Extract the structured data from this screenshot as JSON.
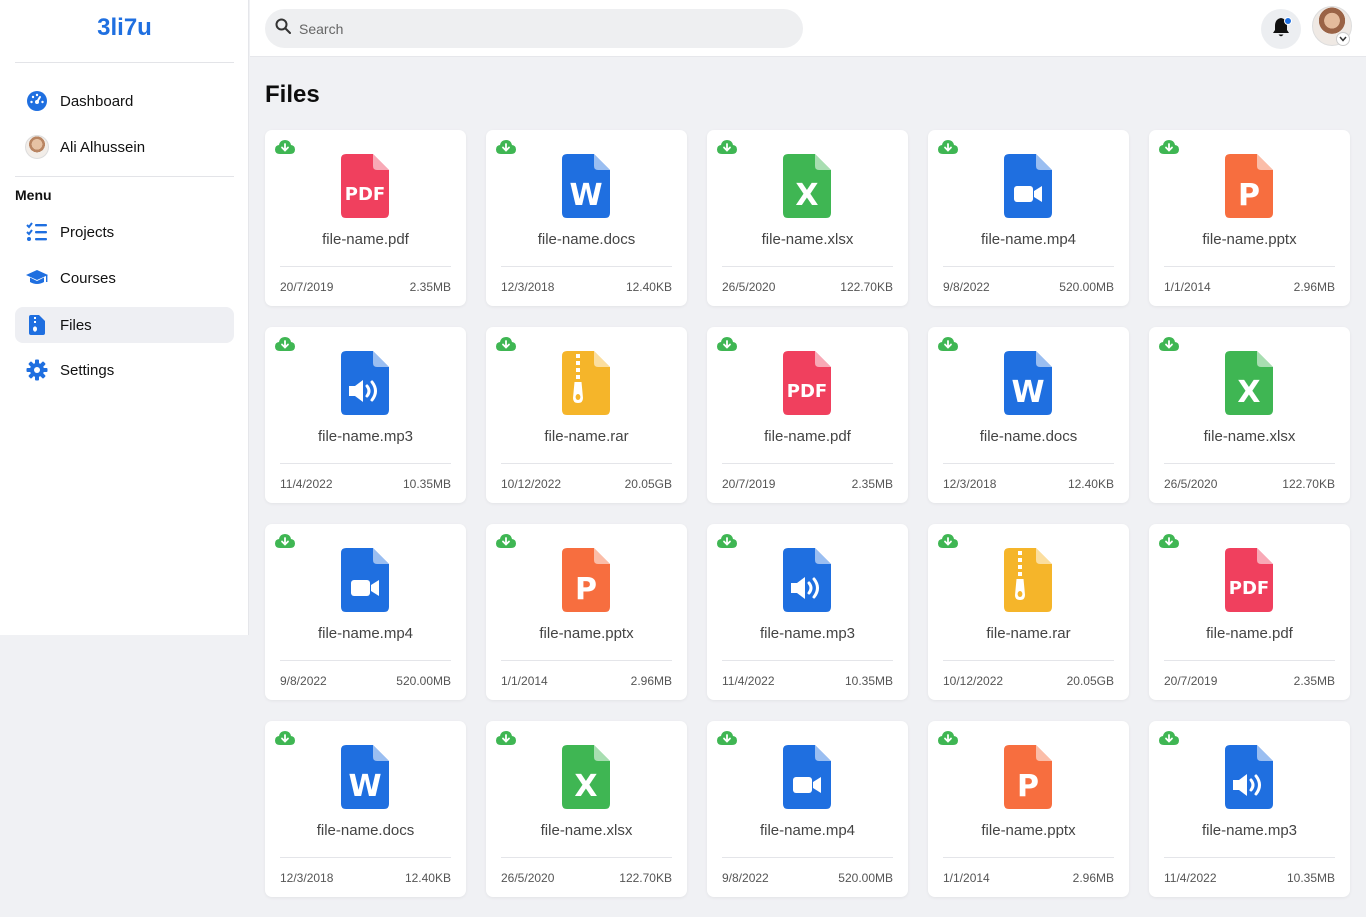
{
  "app": {
    "logo": "3li7u"
  },
  "sidebar": {
    "items": [
      {
        "label": "Dashboard",
        "icon": "gauge-icon"
      },
      {
        "label": "Ali Alhussein",
        "icon": "avatar"
      }
    ],
    "menu_heading": "Menu",
    "menu_items": [
      {
        "label": "Projects",
        "icon": "list-check-icon"
      },
      {
        "label": "Courses",
        "icon": "graduation-cap-icon"
      },
      {
        "label": "Files",
        "icon": "file-zipper-icon",
        "active": true
      },
      {
        "label": "Settings",
        "icon": "gear-icon"
      }
    ]
  },
  "header": {
    "search_placeholder": "Search",
    "notification_icon": "bell-icon",
    "profile_icon": "avatar"
  },
  "main": {
    "title": "Files",
    "files": [
      {
        "name": "file-name.pdf",
        "type": "pdf",
        "date": "20/7/2019",
        "size": "2.35MB"
      },
      {
        "name": "file-name.docs",
        "type": "docs",
        "date": "12/3/2018",
        "size": "12.40KB"
      },
      {
        "name": "file-name.xlsx",
        "type": "xlsx",
        "date": "26/5/2020",
        "size": "122.70KB"
      },
      {
        "name": "file-name.mp4",
        "type": "mp4",
        "date": "9/8/2022",
        "size": "520.00MB"
      },
      {
        "name": "file-name.pptx",
        "type": "pptx",
        "date": "1/1/2014",
        "size": "2.96MB"
      },
      {
        "name": "file-name.mp3",
        "type": "mp3",
        "date": "11/4/2022",
        "size": "10.35MB"
      },
      {
        "name": "file-name.rar",
        "type": "rar",
        "date": "10/12/2022",
        "size": "20.05GB"
      },
      {
        "name": "file-name.pdf",
        "type": "pdf",
        "date": "20/7/2019",
        "size": "2.35MB"
      },
      {
        "name": "file-name.docs",
        "type": "docs",
        "date": "12/3/2018",
        "size": "12.40KB"
      },
      {
        "name": "file-name.xlsx",
        "type": "xlsx",
        "date": "26/5/2020",
        "size": "122.70KB"
      },
      {
        "name": "file-name.mp4",
        "type": "mp4",
        "date": "9/8/2022",
        "size": "520.00MB"
      },
      {
        "name": "file-name.pptx",
        "type": "pptx",
        "date": "1/1/2014",
        "size": "2.96MB"
      },
      {
        "name": "file-name.mp3",
        "type": "mp3",
        "date": "11/4/2022",
        "size": "10.35MB"
      },
      {
        "name": "file-name.rar",
        "type": "rar",
        "date": "10/12/2022",
        "size": "20.05GB"
      },
      {
        "name": "file-name.pdf",
        "type": "pdf",
        "date": "20/7/2019",
        "size": "2.35MB"
      },
      {
        "name": "file-name.docs",
        "type": "docs",
        "date": "12/3/2018",
        "size": "12.40KB"
      },
      {
        "name": "file-name.xlsx",
        "type": "xlsx",
        "date": "26/5/2020",
        "size": "122.70KB"
      },
      {
        "name": "file-name.mp4",
        "type": "mp4",
        "date": "9/8/2022",
        "size": "520.00MB"
      },
      {
        "name": "file-name.pptx",
        "type": "pptx",
        "date": "1/1/2014",
        "size": "2.96MB"
      },
      {
        "name": "file-name.mp3",
        "type": "mp3",
        "date": "11/4/2022",
        "size": "10.35MB"
      }
    ]
  },
  "colors": {
    "accent": "#1f6fe0",
    "pdf": "#f0405e",
    "docs": "#1f6fe0",
    "xlsx": "#3fb653",
    "mp4": "#1f6fe0",
    "pptx": "#f76e3f",
    "mp3": "#1f6fe0",
    "rar": "#f5b52a",
    "download": "#3fb653"
  }
}
